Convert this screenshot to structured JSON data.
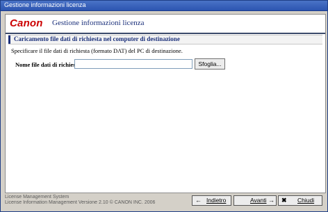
{
  "window": {
    "title": "Gestione informazioni licenza"
  },
  "header": {
    "logo_text": "Canon",
    "app_title": "Gestione informazioni licenza"
  },
  "section": {
    "heading": "Caricamento file dati di richiesta nel computer di destinazione",
    "instruction": "Specificare il file dati di richiesta (formato DAT) del PC di destinazione."
  },
  "form": {
    "field_label": "Nome file dati di richiesta:",
    "field_value": "",
    "browse_label": "Sfoglia..."
  },
  "footer": {
    "line1": "License Management System",
    "line2": "License Information Management Versione 2.10 © CANON INC. 2006"
  },
  "buttons": {
    "back_label": "Indietro",
    "back_icon": "arrow-left-icon",
    "next_label": "Avanti",
    "next_icon": "arrow-right-icon",
    "close_label": "Chiudi",
    "close_icon": "close-icon"
  },
  "colors": {
    "brand": "#cc0000",
    "accent": "#1a2f7a",
    "titlebar": "#2c55b0"
  }
}
